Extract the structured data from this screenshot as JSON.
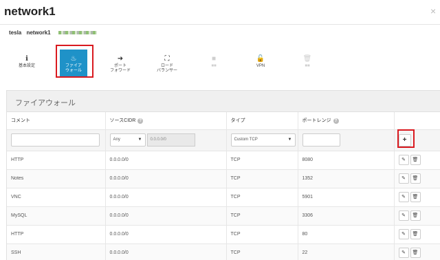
{
  "window": {
    "title": "network1",
    "close_label": "×"
  },
  "breadcrumb": {
    "account": "tesla",
    "network": "network1"
  },
  "toolbar": [
    {
      "icon": "info-icon",
      "glyph": "ℹ",
      "label_lines": [
        "基本設定"
      ],
      "state": "normal"
    },
    {
      "icon": "flame-icon",
      "glyph": "🔥",
      "label_lines": [
        "ファイア",
        "ウォール"
      ],
      "state": "active"
    },
    {
      "icon": "port-forward-icon",
      "glyph": "➜",
      "label_lines": [
        "ポート",
        "フォワード"
      ],
      "state": "normal"
    },
    {
      "icon": "load-balancer-icon",
      "glyph": "⛶",
      "label_lines": [
        "ロード",
        "バランサー"
      ],
      "state": "normal"
    },
    {
      "icon": "disabled-square-icon",
      "glyph": "▪",
      "label_lines": [
        "■■"
      ],
      "state": "disabled"
    },
    {
      "icon": "unlock-icon",
      "glyph": "🔓",
      "label_lines": [
        "VPN"
      ],
      "state": "normal"
    },
    {
      "icon": "trash-icon",
      "glyph": "🗑",
      "label_lines": [
        "■■"
      ],
      "state": "disabled"
    }
  ],
  "panel": {
    "title": "ファイアウォール"
  },
  "table": {
    "headers": {
      "comment": "コメント",
      "source_cidr": "ソースCIDR",
      "type": "タイプ",
      "port_range": "ポートレンジ"
    },
    "new_rule": {
      "comment_value": "",
      "cidr_select": "Any",
      "cidr_value": "0.0.0.0/0",
      "type_select": "Custom TCP",
      "port_value": "",
      "add_label": "+"
    },
    "rows": [
      {
        "comment": "HTTP",
        "cidr": "0.0.0.0/0",
        "type": "TCP",
        "port": "8080"
      },
      {
        "comment": "Notes",
        "cidr": "0.0.0.0/0",
        "type": "TCP",
        "port": "1352"
      },
      {
        "comment": "VNC",
        "cidr": "0.0.0.0/0",
        "type": "TCP",
        "port": "5901"
      },
      {
        "comment": "MySQL",
        "cidr": "0.0.0.0/0",
        "type": "TCP",
        "port": "3306"
      },
      {
        "comment": "HTTP",
        "cidr": "0.0.0.0/0",
        "type": "TCP",
        "port": "80"
      },
      {
        "comment": "SSH",
        "cidr": "0.0.0.0/0",
        "type": "TCP",
        "port": "22"
      }
    ]
  },
  "colors": {
    "accent": "#1f92c8",
    "highlight": "#d9191f"
  }
}
